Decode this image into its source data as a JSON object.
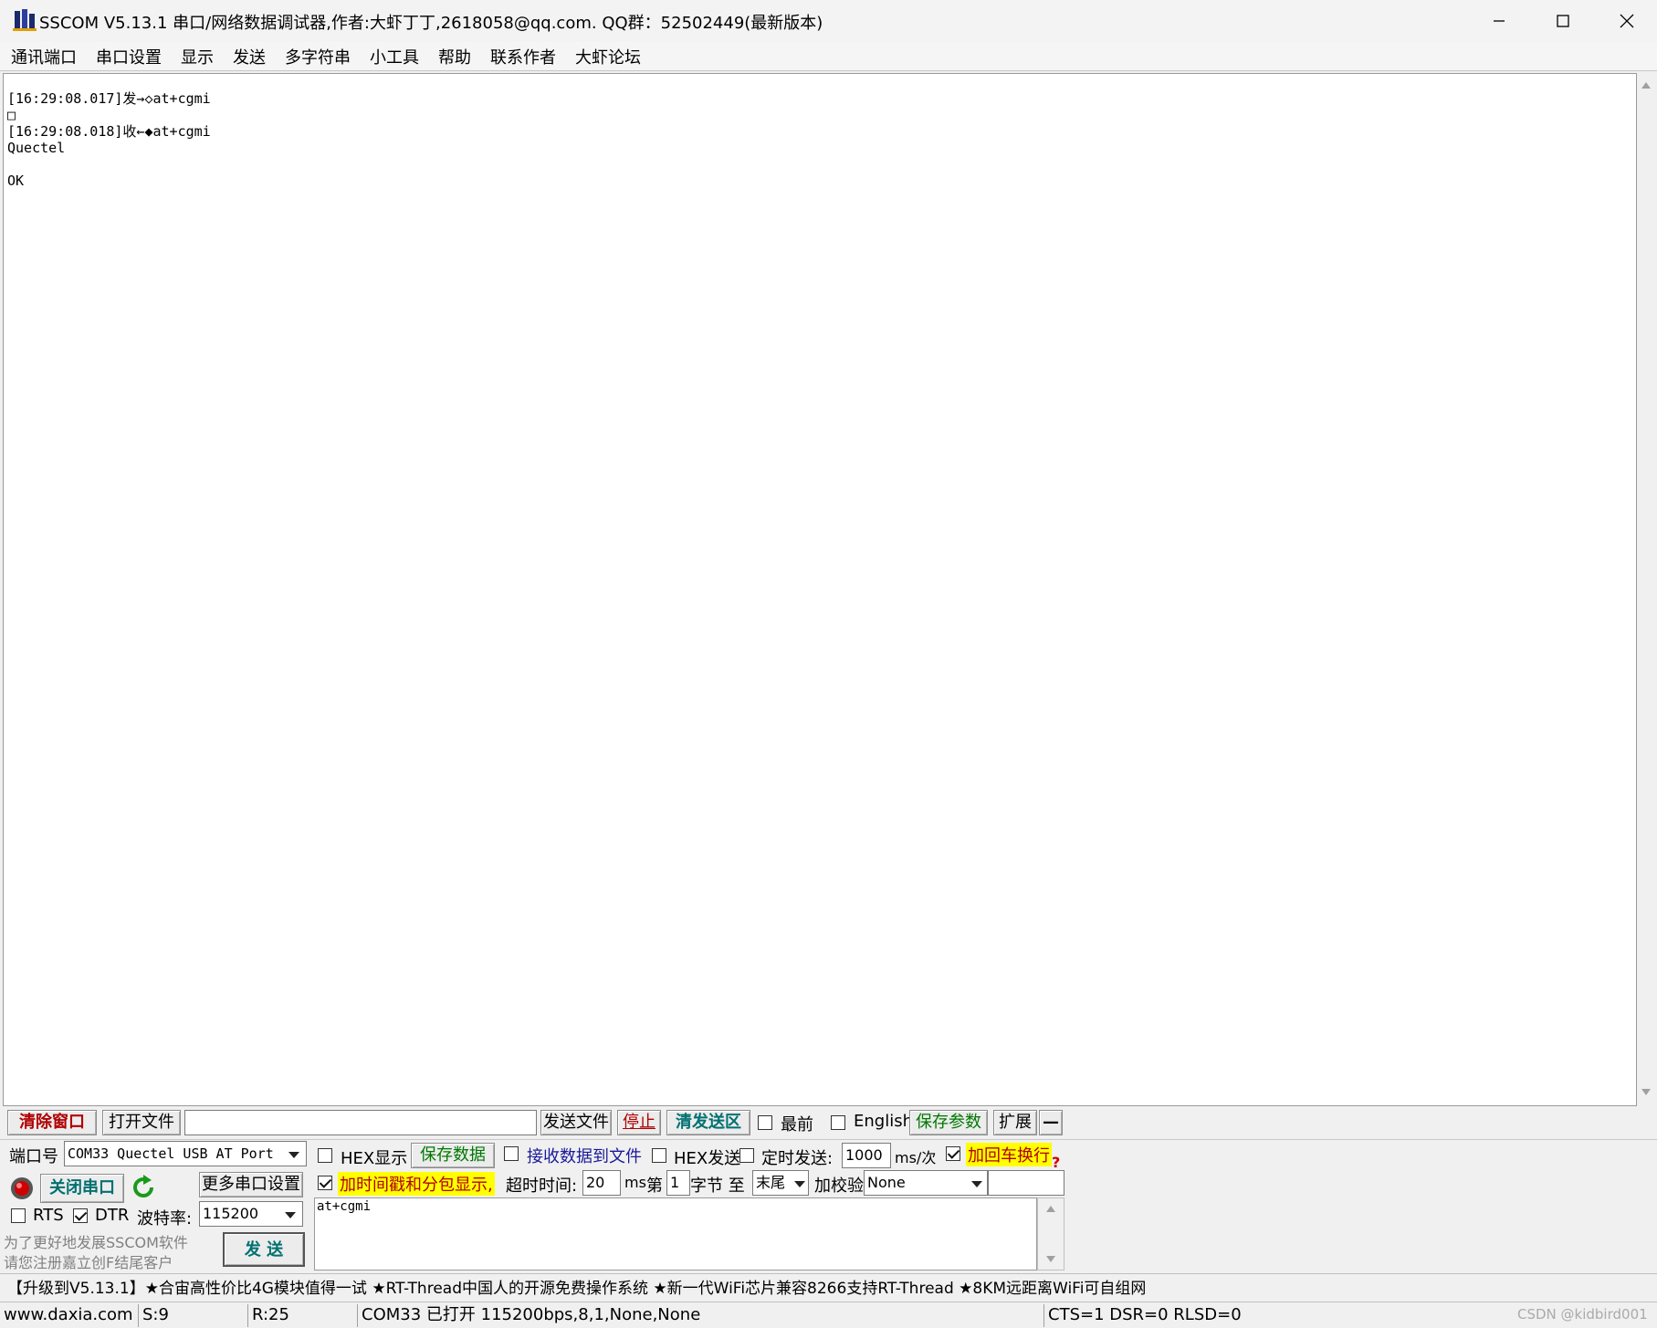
{
  "window": {
    "title": "SSCOM V5.13.1 串口/网络数据调试器,作者:大虾丁丁,2618058@qq.com. QQ群：52502449(最新版本)"
  },
  "menu": [
    "通讯端口",
    "串口设置",
    "显示",
    "发送",
    "多字符串",
    "小工具",
    "帮助",
    "联系作者",
    "大虾论坛"
  ],
  "log": {
    "text": "[16:29:08.017]发→◇at+cgmi\n□\n[16:29:08.018]收←◆at+cgmi\nQuectel\n\nOK"
  },
  "toolbar": {
    "clear_window": "清除窗口",
    "open_file": "打开文件",
    "file_path": "",
    "send_file": "发送文件",
    "stop": "停止",
    "clear_send": "清发送区",
    "topmost": "最前",
    "english": "English",
    "save_params": "保存参数",
    "expand": "扩展",
    "collapse": "—"
  },
  "port": {
    "port_label": "端口号",
    "port_value": "COM33 Quectel USB AT Port",
    "close_port": "关闭串口",
    "more_settings": "更多串口设置",
    "rts": "RTS",
    "dtr": "DTR",
    "baud_label": "波特率:",
    "baud_value": "115200",
    "promo_line1": "为了更好地发展SSCOM软件",
    "promo_line2": "请您注册嘉立创F结尾客户",
    "send": "发  送"
  },
  "options": {
    "hex_display": "HEX显示",
    "save_data": "保存数据",
    "recv_to_file": "接收数据到文件",
    "hex_send": "HEX发送",
    "timed_send": "定时发送:",
    "interval": "1000",
    "interval_unit": "ms/次",
    "add_crlf": "加回车换行",
    "timestamp": "加时间戳和分包显示,",
    "timeout_label": "超时时间:",
    "timeout_value": "20",
    "timeout_unit": "ms",
    "byte_prefix": "第",
    "byte_value": "1",
    "byte_suffix": "字节 至",
    "end_value": "末尾",
    "checksum_label": "加校验",
    "checksum_value": "None",
    "help": "?"
  },
  "send_area": {
    "text": "at+cgmi"
  },
  "promo_bar": "【升级到V5.13.1】★合宙高性价比4G模块值得一试 ★RT-Thread中国人的开源免费操作系统 ★新一代WiFi芯片兼容8266支持RT-Thread ★8KM远距离WiFi可自组网",
  "status": {
    "site": "www.daxia.com",
    "sent": "S:9",
    "recv": "R:25",
    "port_state": "COM33 已打开  115200bps,8,1,None,None",
    "lines": "CTS=1 DSR=0 RLSD=0",
    "watermark": "CSDN @kidbird001"
  },
  "colors": {
    "accent_red": "#b00000",
    "accent_teal": "#007070",
    "accent_green": "#007800",
    "highlight": "#ffff00"
  }
}
